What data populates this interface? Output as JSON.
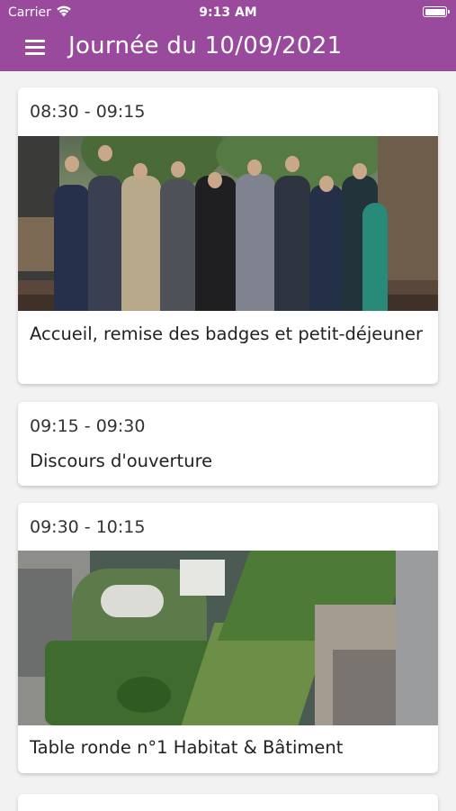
{
  "status_bar": {
    "carrier": "Carrier",
    "time": "9:13 AM"
  },
  "header": {
    "title": "Journée du 10/09/2021",
    "menu_icon": "hamburger-menu-icon",
    "background_color": "#9a4a9c"
  },
  "sessions": [
    {
      "time": "08:30 - 09:15",
      "title": "Accueil, remise des badges et petit-déjeuner",
      "has_photo": true,
      "photo_subject": "group-photo"
    },
    {
      "time": "09:15 - 09:30",
      "title": "Discours d'ouverture",
      "has_photo": false
    },
    {
      "time": "09:30 - 10:15",
      "title": "Table ronde n°1 Habitat & Bâtiment",
      "has_photo": true,
      "photo_subject": "green-roofs-aerial"
    }
  ]
}
